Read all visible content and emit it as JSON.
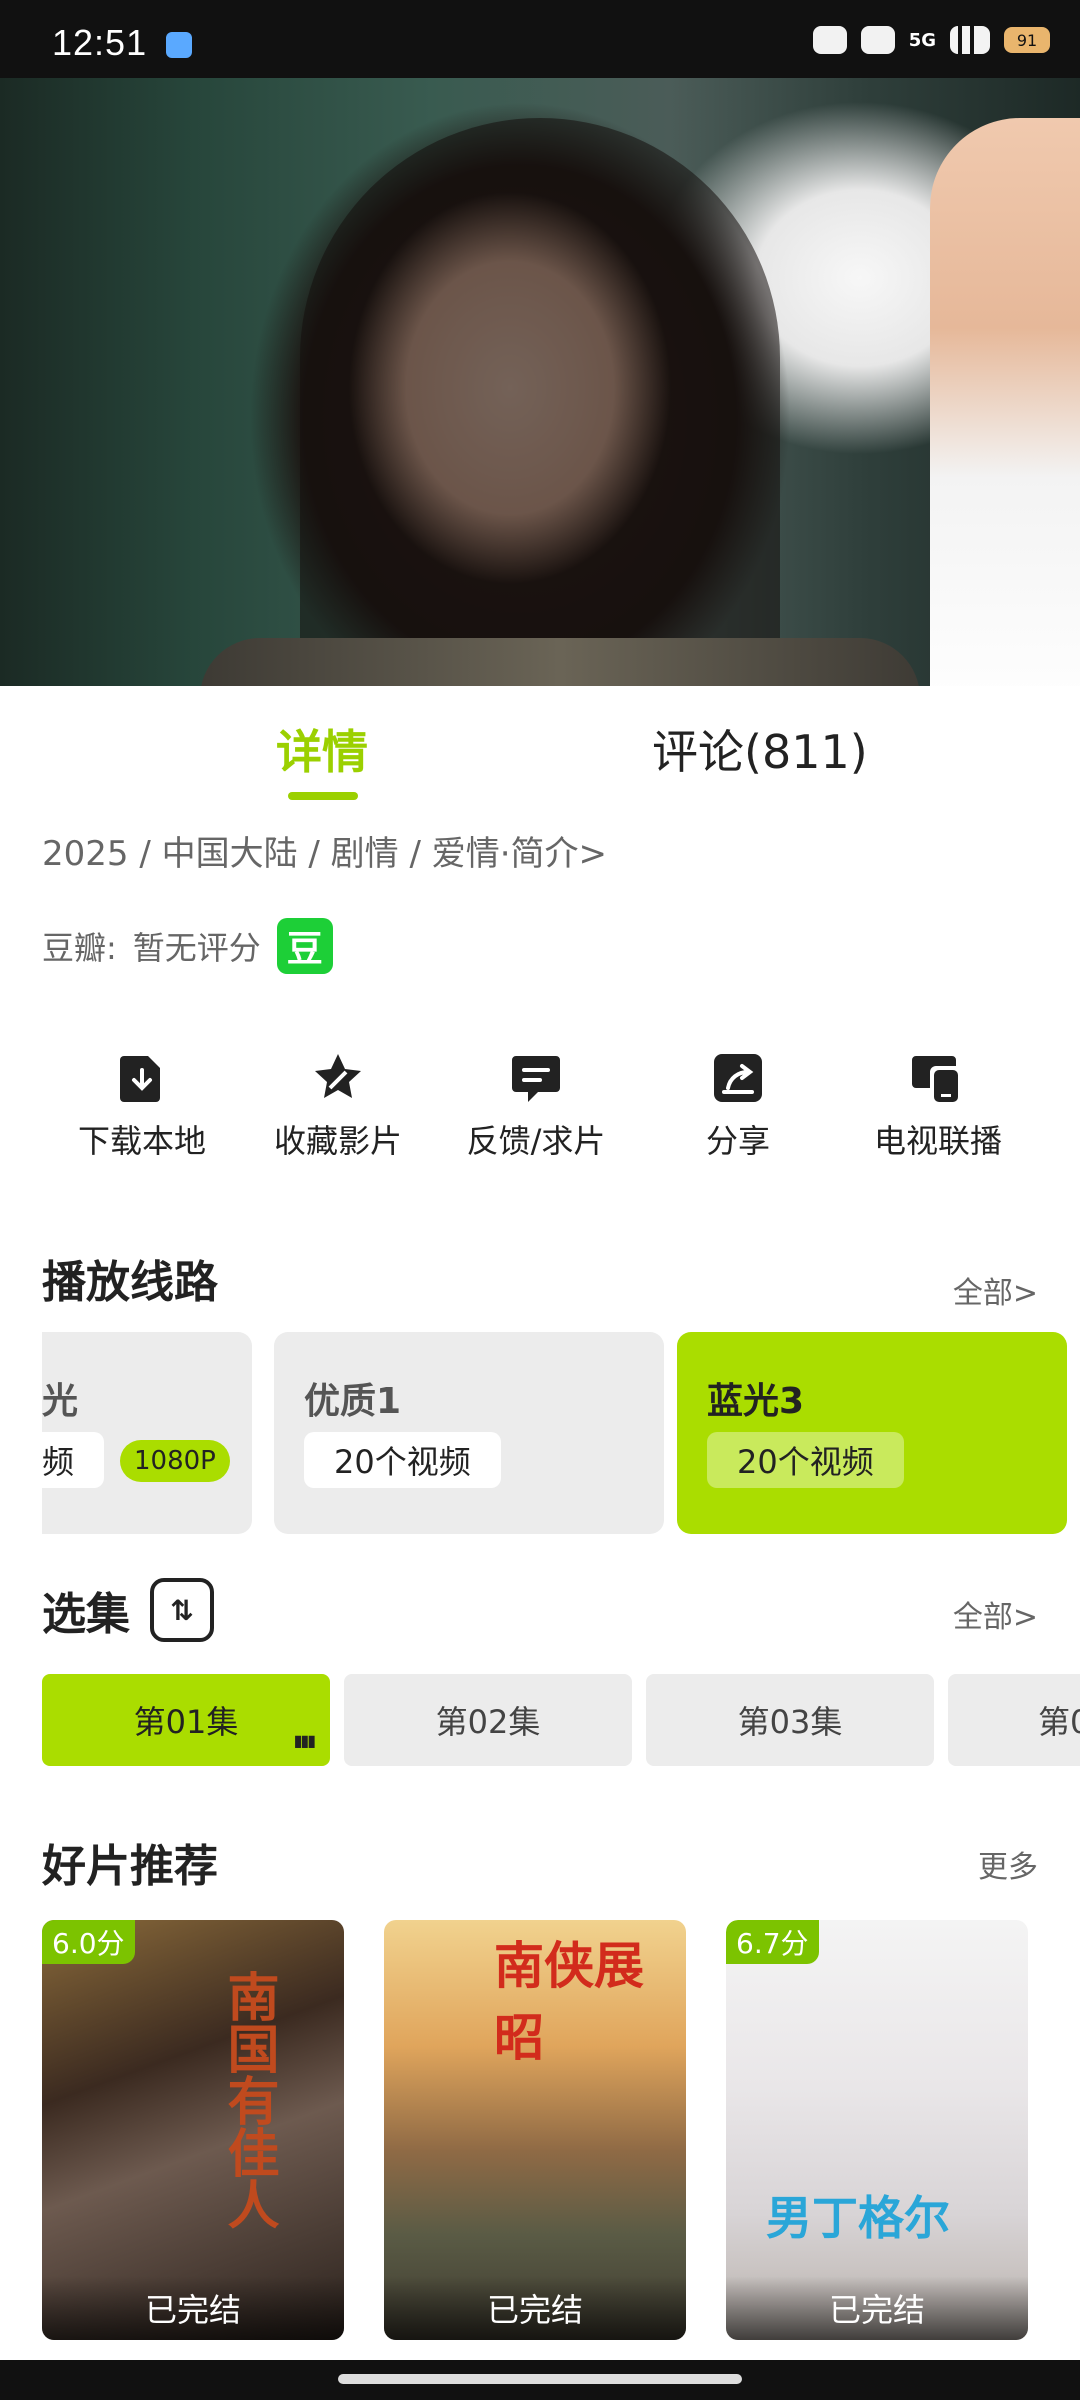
{
  "status_bar": {
    "time": "12:51",
    "network": "5G",
    "battery": "91"
  },
  "tabs": [
    {
      "label": "详情",
      "active": true
    },
    {
      "label": "评论(811)",
      "active": false
    }
  ],
  "meta": {
    "info": "2025 / 中国大陆 / 剧情 / 爱情·简介>"
  },
  "douban": {
    "label": "豆瓣:",
    "rating": "暂无评分",
    "badge": "豆"
  },
  "actions": [
    {
      "label": "下载本地",
      "icon": "download-icon"
    },
    {
      "label": "收藏影片",
      "icon": "star-icon"
    },
    {
      "label": "反馈/求片",
      "icon": "feedback-icon"
    },
    {
      "label": "分享",
      "icon": "share-icon"
    },
    {
      "label": "电视联播",
      "icon": "tv-cast-icon"
    }
  ],
  "play_lines": {
    "title": "播放线路",
    "more": "全部>",
    "items": [
      {
        "name": "光",
        "count": "频",
        "badge": "1080P",
        "selected": false
      },
      {
        "name": "优质1",
        "count": "20个视频",
        "selected": false
      },
      {
        "name": "蓝光3",
        "count": "20个视频",
        "selected": true
      }
    ]
  },
  "episodes": {
    "title": "选集",
    "more": "全部>",
    "sort_icon": "sort-icon",
    "items": [
      {
        "label": "第01集",
        "selected": true
      },
      {
        "label": "第02集",
        "selected": false
      },
      {
        "label": "第03集",
        "selected": false
      },
      {
        "label": "第0",
        "selected": false
      }
    ]
  },
  "recommendations": {
    "title": "好片推荐",
    "more": "更多",
    "items": [
      {
        "title": "南国有佳人",
        "score": "6.0分",
        "status": "已完结"
      },
      {
        "title": "南侠展昭",
        "score": "",
        "status": "已完结"
      },
      {
        "title": "男丁格尔",
        "score": "6.7分",
        "status": "已完结"
      }
    ]
  },
  "colors": {
    "accent": "#9bd000",
    "accent_bg": "#aadd00",
    "douban_green": "#1dcf37"
  }
}
